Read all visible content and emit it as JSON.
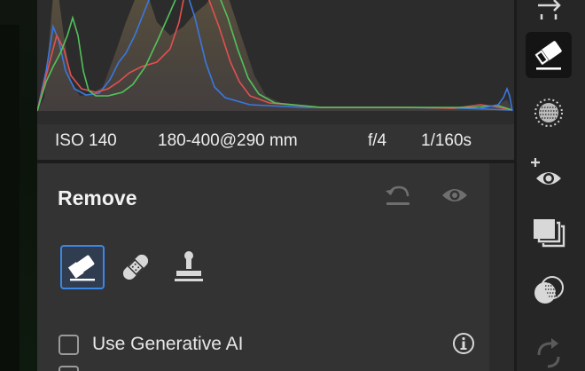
{
  "exif": {
    "iso": "ISO 140",
    "focal": "180-400@290 mm",
    "aperture": "f/4",
    "shutter": "1/160s"
  },
  "remove": {
    "title": "Remove",
    "tools": [
      {
        "name": "eraser-tool",
        "icon": "eraser-icon",
        "active": true
      },
      {
        "name": "heal-tool",
        "icon": "bandage-icon",
        "active": false
      },
      {
        "name": "clone-tool",
        "icon": "stamp-icon",
        "active": false
      }
    ],
    "generative_ai": {
      "label": "Use Generative AI",
      "checked": false
    }
  },
  "toolstrip": {
    "items": [
      {
        "icon": "transform-icon",
        "active": false
      },
      {
        "icon": "eraser-icon",
        "active": true
      },
      {
        "icon": "masking-icon",
        "active": false
      },
      {
        "icon": "red-eye-icon",
        "active": false
      },
      {
        "icon": "presets-icon",
        "active": false
      },
      {
        "icon": "blend-icon",
        "active": false
      },
      {
        "icon": "sync-icon",
        "active": false
      }
    ]
  },
  "colors": {
    "accent": "#3c86e6",
    "panel": "#333333",
    "histogram_red": "#e25050",
    "histogram_green": "#52c25a",
    "histogram_blue": "#3a78e0"
  }
}
